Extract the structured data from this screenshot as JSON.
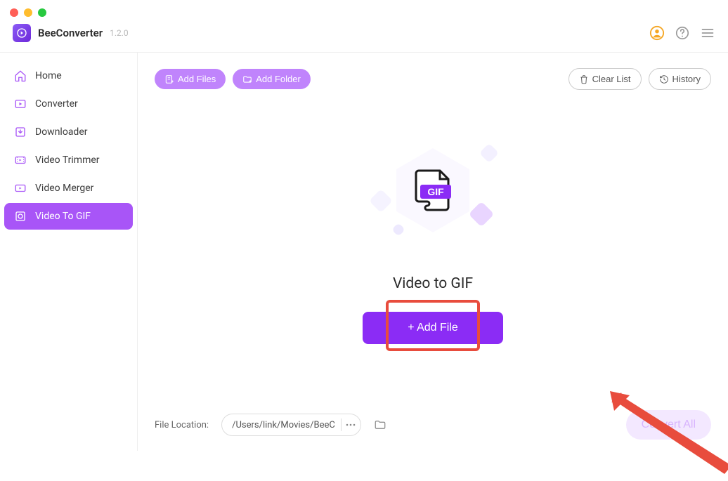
{
  "app": {
    "name": "BeeConverter",
    "version": "1.2.0"
  },
  "sidebar": {
    "items": [
      {
        "label": "Home",
        "icon": "home"
      },
      {
        "label": "Converter",
        "icon": "converter"
      },
      {
        "label": "Downloader",
        "icon": "download"
      },
      {
        "label": "Video Trimmer",
        "icon": "trimmer"
      },
      {
        "label": "Video Merger",
        "icon": "merger"
      },
      {
        "label": "Video To GIF",
        "icon": "gif",
        "active": true
      }
    ]
  },
  "toolbar": {
    "add_files": "Add Files",
    "add_folder": "Add Folder",
    "clear_list": "Clear List",
    "history": "History"
  },
  "hero": {
    "title": "Video to GIF",
    "add_file_button": "+ Add File",
    "gif_badge": "GIF"
  },
  "footer": {
    "location_label": "File Location:",
    "location_path": "/Users/link/Movies/BeeC",
    "convert_all": "Convert All"
  }
}
